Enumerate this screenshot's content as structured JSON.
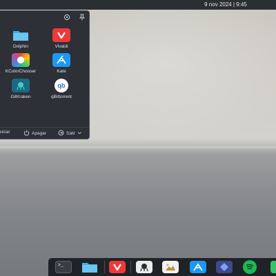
{
  "panel": {
    "clock": "9 nov 2024 | 9:45"
  },
  "launcher": {
    "header_icons": [
      "settings-icon",
      "pin-icon"
    ],
    "apps": [
      {
        "label": "Dolphin",
        "icon": "folder-icon",
        "color": "#3daee9"
      },
      {
        "label": "Vivaldi",
        "icon": "vivaldi-icon",
        "color": "#ef3939"
      },
      {
        "label": "KColorChooser",
        "icon": "color-chooser-icon",
        "color": "#e8c43c"
      },
      {
        "label": "Kate",
        "icon": "kate-icon",
        "color": "#1d99f3"
      },
      {
        "label": "GitKraken",
        "icon": "gitkraken-icon",
        "color": "#17928a"
      },
      {
        "label": "qBittorrent",
        "icon": "qbittorrent-icon",
        "color": "#4f8fd6"
      }
    ],
    "footer": {
      "restart_label": "eiciar",
      "shutdown_label": "Apagar",
      "logout_label": "Salir"
    }
  },
  "dock": {
    "items": [
      "terminal-icon",
      "folder-icon",
      "vivaldi-icon",
      "gitkraken-icon",
      "image-viewer-icon",
      "kate-icon",
      "app-icon",
      "spotify-icon",
      "cut-off-icon"
    ]
  }
}
